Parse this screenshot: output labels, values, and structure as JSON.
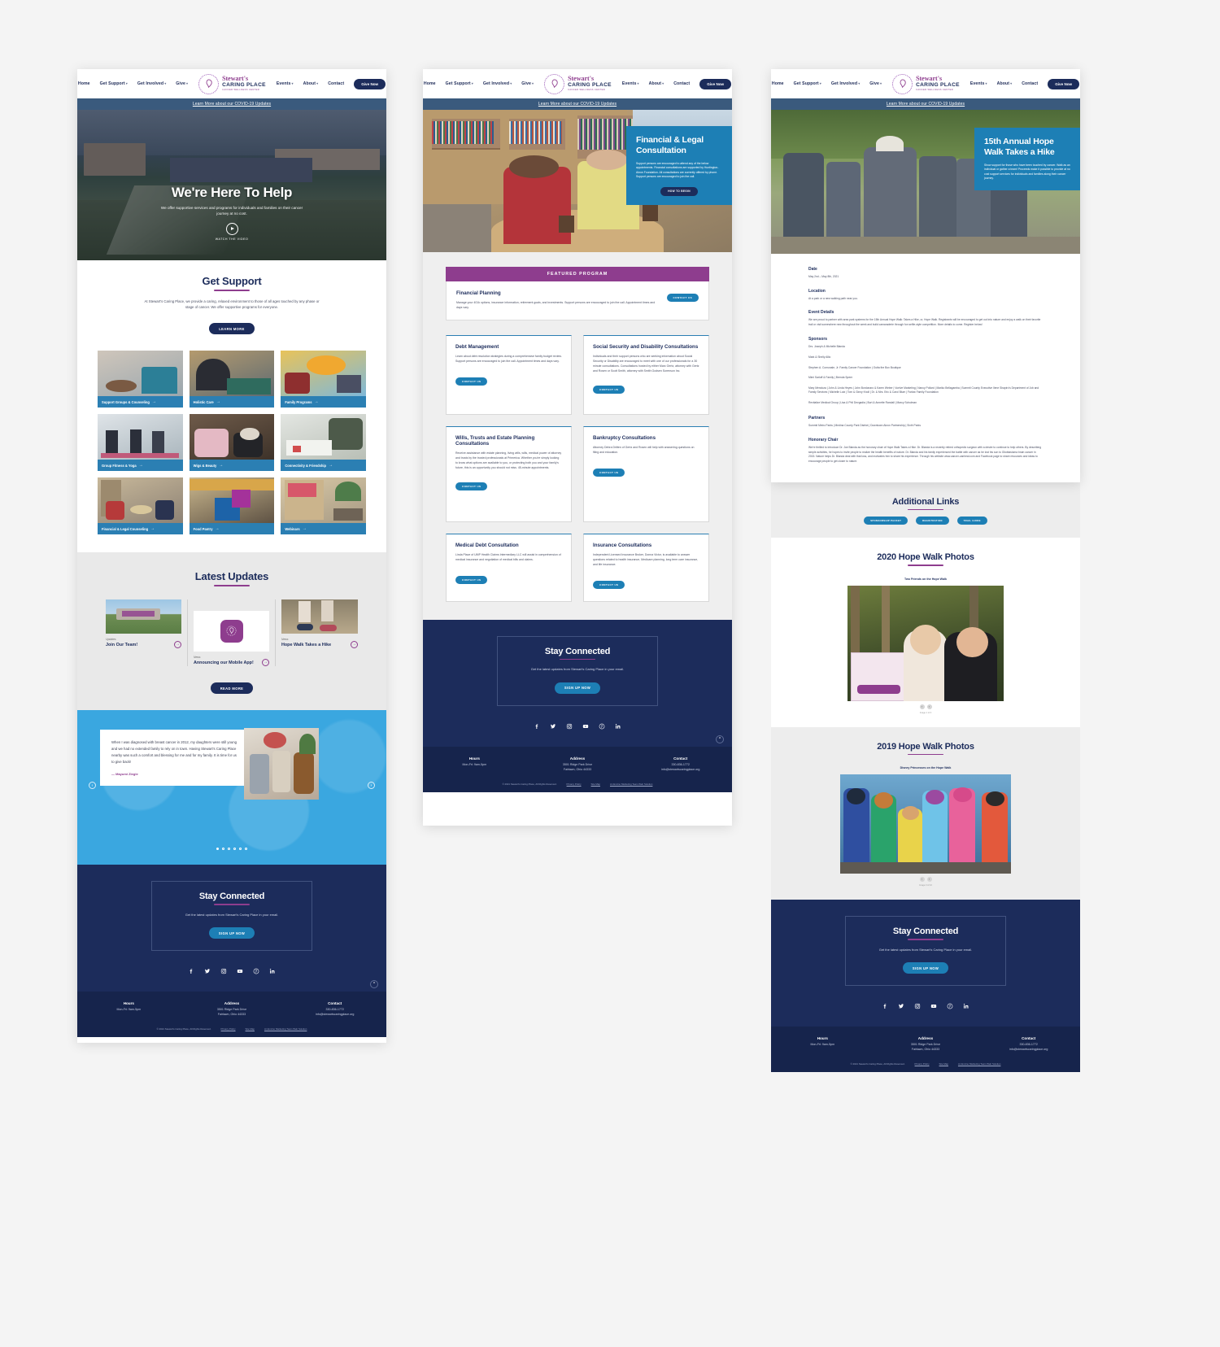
{
  "brand": {
    "name_line1": "Stewart's",
    "name_line2": "CARING PLACE",
    "tagline": "CANCER WELLNESS CENTER",
    "accent_purple": "#8e3d8e",
    "accent_navy": "#1c2c5b",
    "accent_blue": "#1d7fb5"
  },
  "nav": {
    "left": [
      "Home",
      "Get Support",
      "Get Involved",
      "Give"
    ],
    "right": [
      "Events",
      "About",
      "Contact"
    ],
    "cta": "Give Now",
    "covid_banner": "Learn More about our COVID-19 Updates"
  },
  "page1": {
    "hero": {
      "title": "We're Here To Help",
      "subtitle": "We offer supportive services and programs for individuals and families on their cancer journey at no cost.",
      "watch_label": "WATCH THE VIDEO"
    },
    "get_support": {
      "title": "Get Support",
      "body": "At Stewart's Caring Place, we provide a caring, relaxed environment to those of all ages touched by any phase or stage of cancer. We offer supportive programs for everyone.",
      "button": "LEARN MORE",
      "cards": [
        "Support Groups & Counseling",
        "Holistic Care",
        "Family Programs",
        "Group Fitness & Yoga",
        "Wigs & Beauty",
        "Connectivity & Friendship",
        "Financial & Legal Counseling",
        "Food Pantry",
        "Webinars"
      ]
    },
    "latest_updates": {
      "title": "Latest Updates",
      "button": "READ MORE",
      "items": [
        {
          "kicker": "Updates",
          "title": "Join Our Team!"
        },
        {
          "kicker": "News",
          "title": "Announcing our Mobile App!"
        },
        {
          "kicker": "News",
          "title": "Hope Walk Takes a Hike"
        }
      ]
    },
    "testimonial": {
      "quote": "When I was diagnosed with breast cancer in 2012, my daughters were still young and we had no extended family to rely on in town. Having Stewart's Caring Place nearby was such a comfort and blessing for me and for my family. It is time for us to give back!",
      "author": "— Mayumi Ziegle",
      "slide_count": 6,
      "active_slide": 1
    }
  },
  "page2": {
    "hero": {
      "title": "Financial & Legal Consultation",
      "body": "Support persons are encouraged to attend any of the below appointments. Financial consultations are supported by Huntington-Akron Foundation. All consultations are currently offered by phone. Support persons are encouraged to join the call.",
      "button": "HOW TO BEGIN"
    },
    "featured": {
      "banner": "FEATURED PROGRAM",
      "title": "Financial Planning",
      "body": "Manage your 401k options, insurance information, retirement goals, and investments. Support persons are encouraged to join the call. Appointment times and days vary.",
      "button": "CONTACT US"
    },
    "programs": [
      {
        "title": "Debt Management",
        "body": "Learn about debt resolution strategies during a comprehensive family budget review. Support persons are encouraged to join the call. Appointment times and days vary.",
        "button": "CONTACT US"
      },
      {
        "title": "Social Security and Disability Consultations",
        "body": "Individuals and their support persons who are seeking information about Social Security or Disability are encouraged to meet with one of our professionals for a 30 minute consultations. Consultations hosted by either Marc Gertz, attorney with Gertz and Rosen or Scott Smith, attorney with Smith Godsen Sorenson Inc.",
        "button": "CONTACT US"
      },
      {
        "title": "Wills, Trusts and Estate Planning Consultations",
        "body": "Receive assistance with estate planning, living wills, wills, medical power of attorney and trusts by the trusted professionals at Primerica. Whether you're simply looking to know what options are available to you, or protecting both you and your family's future, this is an opportunity you should not miss. 45-minute appointments.",
        "button": "CONTACT US"
      },
      {
        "title": "Bankruptcy Consultations",
        "body": "Attorney Debra Dritten of Gertz and Rosen will help with answering questions on filing and education.",
        "button": "CONTACT US"
      },
      {
        "title": "Medical Debt Consultation",
        "body": "Linda Place of UMP Health Claims Intermediary LLC will assist in comprehension of medical insurance and negotiation of medical bills and claims.",
        "button": "CONTACT US"
      },
      {
        "title": "Insurance Consultations",
        "body": "Independent Licensed Insurance Broker, Donna Victor, is available to answer questions related to health insurance, Medicare planning, long term care insurance, and life insurance.",
        "button": "CONTACT US"
      }
    ]
  },
  "page3": {
    "hero": {
      "title": "15th Annual Hope Walk Takes a Hike",
      "body": "Show support for those who have been touched by cancer. Walk as an individual or gather a team! Proceeds make it possible to provide at no cost support services for individuals and families along their cancer journey."
    },
    "details": [
      {
        "heading": "Date",
        "text": "May 2nd – May 8th, 2021"
      },
      {
        "heading": "Location",
        "text": "At a park or a new walking path near you."
      },
      {
        "heading": "Event Details",
        "text": "We are proud to partner with area park systems for the 15th Annual Hope Walk: Takes a Hike, or, Hope Walk. Registrants will be encouraged to get out into nature and enjoy a walk on their favorite trail or visit somewhere new throughout the week and build camaraderie through fun selfie-style competition. More details to come. Register below!"
      }
    ],
    "sponsors": {
      "heading": "Sponsors",
      "lines": [
        "Drs. Joseph & Michelle Blanda",
        "Mark & Shelly Allio",
        "Stephen A. Comunale, Jr. Family Cancer Foundation | Outta the Box Boutique",
        "Mimi Sarloff & Family | Brenda Speer",
        "Mary Mendoza | John & Linda Heyes | John Bordonaro & Karen Weber | Vuelve Marketing | Nancy Pollard | Mariko Bellagamba | Summit County Executive Ilene Shapiro's Department of Job and Family Services | Michelle Lutz | Tom & Ginny Knoll | Dr. & Mrs. Eric & Carol Blum | Farlow Family Foundation",
        "Revitalize Medical Group | Lisa & Phil Devgadia | Burt & Annette Randall | Marcy Schulman"
      ]
    },
    "partners": {
      "heading": "Partners",
      "text": "Summit Metro Parks | Medina County Park District | Downtown Akron Partnership | Sixth Parks"
    },
    "honorary": {
      "heading": "Honorary Chair",
      "text": "We're thrilled to introduce Dr. Joe Blanda as the honorary chair of Hope Walk Takes a Hike. Dr. Blanda is a recently retired orthopedic surgeon with a desire to continue to help others. By describing simple activities, he hopes to invite people to realize the health benefits of nature. Dr. Blanda and his family experienced the battle with cancer as he lost his son to Glioblastoma brain cancer in 2015. Nature helps Dr. Blanda deal with that loss, and motivates him to share his experience. Through his website www.cancer-canheal.com and Facebook page to share resources and ideas to encourage people to get closer to nature."
    },
    "additional_links": {
      "title": "Additional Links",
      "links": [
        "SPONSORSHIP PACKET",
        "REGISTRATION",
        "TRAIL GUIDE"
      ]
    },
    "galleries": [
      {
        "title": "2020 Hope Walk Photos",
        "caption": "Two Friends on the Hope Walk",
        "count": "Image 1 of 4"
      },
      {
        "title": "2019 Hope Walk Photos",
        "caption": "Disney Princesses on the Hope Walk",
        "count": "Image 3 of 10"
      }
    ]
  },
  "stay_connected": {
    "title": "Stay Connected",
    "subtitle": "Get the latest updates from Stewart's Caring Place in your email.",
    "button": "SIGN UP NOW",
    "socials": [
      "facebook-icon",
      "twitter-icon",
      "instagram-icon",
      "youtube-icon",
      "pinterest-icon",
      "linkedin-icon"
    ]
  },
  "footer": {
    "columns": [
      {
        "heading": "Hours",
        "lines": [
          "Mon-Fri: 9am-5pm"
        ]
      },
      {
        "heading": "Address",
        "lines": [
          "3501 Ridge Park Drive",
          "Fairlawn, Ohio 44333"
        ]
      },
      {
        "heading": "Contact",
        "lines": [
          "330-836-1772",
          "info@stewartscaringplace.org"
        ]
      }
    ],
    "legal": [
      "© 2021 Stewart's Caring Place, All Rights Reserved.",
      "Privacy Policy",
      "Site Map",
      "An Encino Marketing Team Web Solution"
    ]
  }
}
